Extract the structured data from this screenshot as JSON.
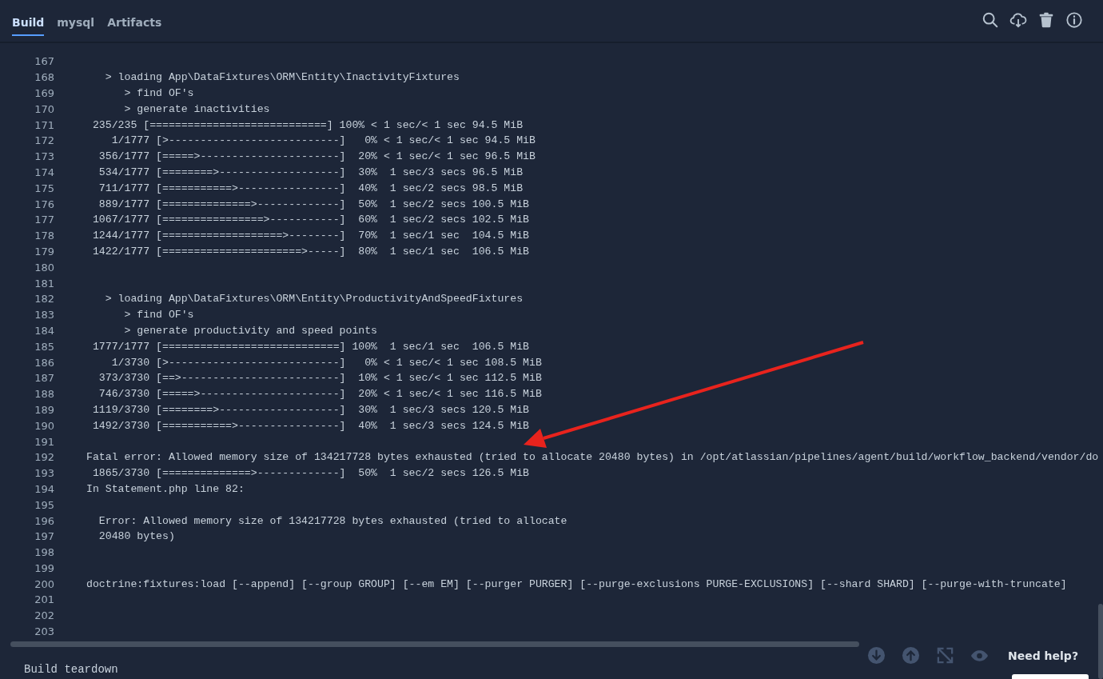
{
  "tabs": [
    {
      "label": "Build",
      "selected": true
    },
    {
      "label": "mysql",
      "selected": false
    },
    {
      "label": "Artifacts",
      "selected": false
    }
  ],
  "log": {
    "lines": [
      {
        "number": "167"
      },
      {
        "number": "168",
        "text": "   > loading App\\DataFixtures\\ORM\\Entity\\InactivityFixtures"
      },
      {
        "number": "169",
        "text": "      > find OF's"
      },
      {
        "number": "170",
        "text": "      > generate inactivities"
      },
      {
        "number": "171",
        "text": " 235/235 [============================] 100% < 1 sec/< 1 sec 94.5 MiB"
      },
      {
        "number": "172",
        "text": "    1/1777 [>---------------------------]   0% < 1 sec/< 1 sec 94.5 MiB"
      },
      {
        "number": "173",
        "text": "  356/1777 [=====>----------------------]  20% < 1 sec/< 1 sec 96.5 MiB"
      },
      {
        "number": "174",
        "text": "  534/1777 [========>-------------------]  30%  1 sec/3 secs 96.5 MiB"
      },
      {
        "number": "175",
        "text": "  711/1777 [===========>----------------]  40%  1 sec/2 secs 98.5 MiB"
      },
      {
        "number": "176",
        "text": "  889/1777 [==============>-------------]  50%  1 sec/2 secs 100.5 MiB"
      },
      {
        "number": "177",
        "text": " 1067/1777 [================>-----------]  60%  1 sec/2 secs 102.5 MiB"
      },
      {
        "number": "178",
        "text": " 1244/1777 [===================>--------]  70%  1 sec/1 sec  104.5 MiB"
      },
      {
        "number": "179",
        "text": " 1422/1777 [======================>-----]  80%  1 sec/1 sec  106.5 MiB"
      },
      {
        "number": "180"
      },
      {
        "number": "181"
      },
      {
        "number": "182",
        "text": "   > loading App\\DataFixtures\\ORM\\Entity\\ProductivityAndSpeedFixtures"
      },
      {
        "number": "183",
        "text": "      > find OF's"
      },
      {
        "number": "184",
        "text": "      > generate productivity and speed points"
      },
      {
        "number": "185",
        "text": " 1777/1777 [============================] 100%  1 sec/1 sec  106.5 MiB"
      },
      {
        "number": "186",
        "text": "    1/3730 [>---------------------------]   0% < 1 sec/< 1 sec 108.5 MiB"
      },
      {
        "number": "187",
        "text": "  373/3730 [==>-------------------------]  10% < 1 sec/< 1 sec 112.5 MiB"
      },
      {
        "number": "188",
        "text": "  746/3730 [=====>----------------------]  20% < 1 sec/< 1 sec 116.5 MiB"
      },
      {
        "number": "189",
        "text": " 1119/3730 [========>-------------------]  30%  1 sec/3 secs 120.5 MiB"
      },
      {
        "number": "190",
        "text": " 1492/3730 [===========>----------------]  40%  1 sec/3 secs 124.5 MiB"
      },
      {
        "number": "191"
      },
      {
        "number": "192",
        "text": "Fatal error: Allowed memory size of 134217728 bytes exhausted (tried to allocate 20480 bytes) in /opt/atlassian/pipelines/agent/build/workflow_backend/vendor/do"
      },
      {
        "number": "193",
        "text": " 1865/3730 [==============>-------------]  50%  1 sec/2 secs 126.5 MiB"
      },
      {
        "number": "194",
        "text": "In Statement.php line 82:"
      },
      {
        "number": "195"
      },
      {
        "number": "196",
        "text": "  Error: Allowed memory size of 134217728 bytes exhausted (tried to allocate"
      },
      {
        "number": "197",
        "text": "  20480 bytes)"
      },
      {
        "number": "198"
      },
      {
        "number": "199"
      },
      {
        "number": "200",
        "text": "doctrine:fixtures:load [--append] [--group GROUP] [--em EM] [--purger PURGER] [--purge-exclusions PURGE-EXCLUSIONS] [--shard SHARD] [--purge-with-truncate]"
      },
      {
        "number": "201"
      },
      {
        "number": "202"
      },
      {
        "number": "203"
      }
    ]
  },
  "footer": {
    "section_title": "Build teardown"
  },
  "help": {
    "label": "Need help?"
  }
}
